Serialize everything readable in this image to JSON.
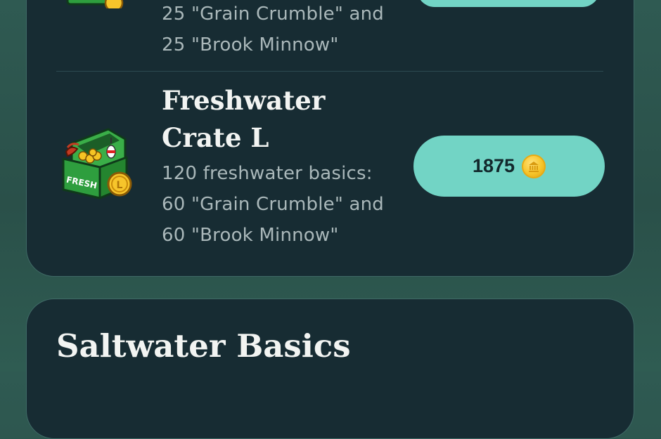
{
  "items": [
    {
      "desc_lines": [
        "25 \"Grain Crumble\" and",
        "25 \"Brook Minnow\""
      ],
      "icon": "treasure-chest-icon"
    },
    {
      "title_lines": [
        "Freshwater",
        "Crate L"
      ],
      "desc_lines": [
        "120 freshwater basics:",
        "60 \"Grain Crumble\" and",
        "60 \"Brook Minnow\""
      ],
      "price": "1875",
      "chest_label": "FRESH",
      "icon": "treasure-chest-icon",
      "currency_icon": "gold-coin-icon"
    }
  ],
  "section": {
    "title": "Saltwater Basics"
  },
  "colors": {
    "background": "#2d564e",
    "card": "#172c33",
    "button": "#72d4c5",
    "coin": "#f7c52b",
    "chest": "#2e9e3e"
  }
}
